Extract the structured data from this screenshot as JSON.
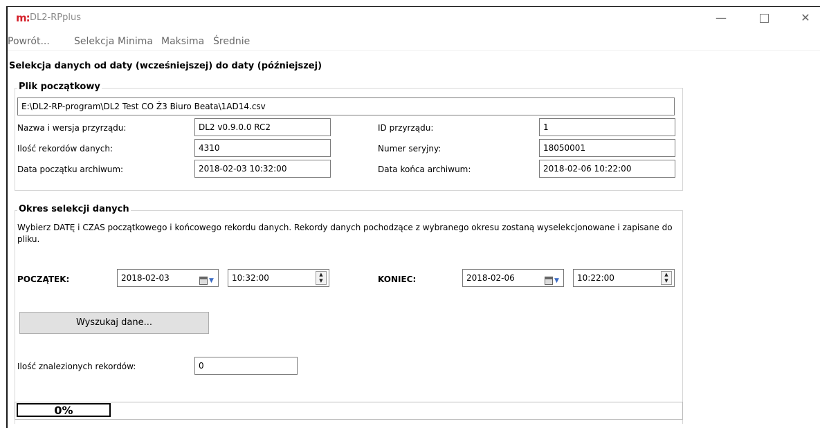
{
  "window": {
    "logo": "m:",
    "title": "DL2-RPplus",
    "minimize": "—",
    "close": "✕"
  },
  "menu": [
    "Powrót...",
    "Selekcja",
    "Minima",
    "Maksima",
    "Średnie"
  ],
  "page_title": "Selekcja danych od daty (wcześniejszej) do daty (późniejszej)",
  "source_file": {
    "group_title": "Plik początkowy",
    "path": "E:\\DL2-RP-program\\DL2 Test CO Ż3 Biuro Beata\\1AD14.csv",
    "device_name_label": "Nazwa i wersja przyrządu:",
    "device_name_value": "DL2 v0.9.0.0 RC2",
    "device_id_label": "ID przyrządu:",
    "device_id_value": "1",
    "records_label": "Ilość rekordów danych:",
    "records_value": "4310",
    "serial_label": "Numer seryjny:",
    "serial_value": "18050001",
    "archive_start_label": "Data początku archiwum:",
    "archive_start_value": "2018-02-03 10:32:00",
    "archive_end_label": "Data końca archiwum:",
    "archive_end_value": "2018-02-06 10:22:00"
  },
  "selection": {
    "group_title": "Okres selekcji danych",
    "description": "Wybierz DATĘ i CZAS początkowego i końcowego rekordu danych. Rekordy danych pochodzące z wybranego okresu zostaną wyselekcjonowane i zapisane do pliku.",
    "start_label": "POCZĄTEK:",
    "start_date": "2018-02-03",
    "start_time": "10:32:00",
    "end_label": "KONIEC:",
    "end_date": "2018-02-06",
    "end_time": "10:22:00",
    "search_button": "Wyszukaj dane...",
    "found_label": "Ilość znalezionych rekordów:",
    "found_value": "0"
  },
  "progress": {
    "label": "0%",
    "value": 0,
    "fill_color": "#06b025"
  }
}
